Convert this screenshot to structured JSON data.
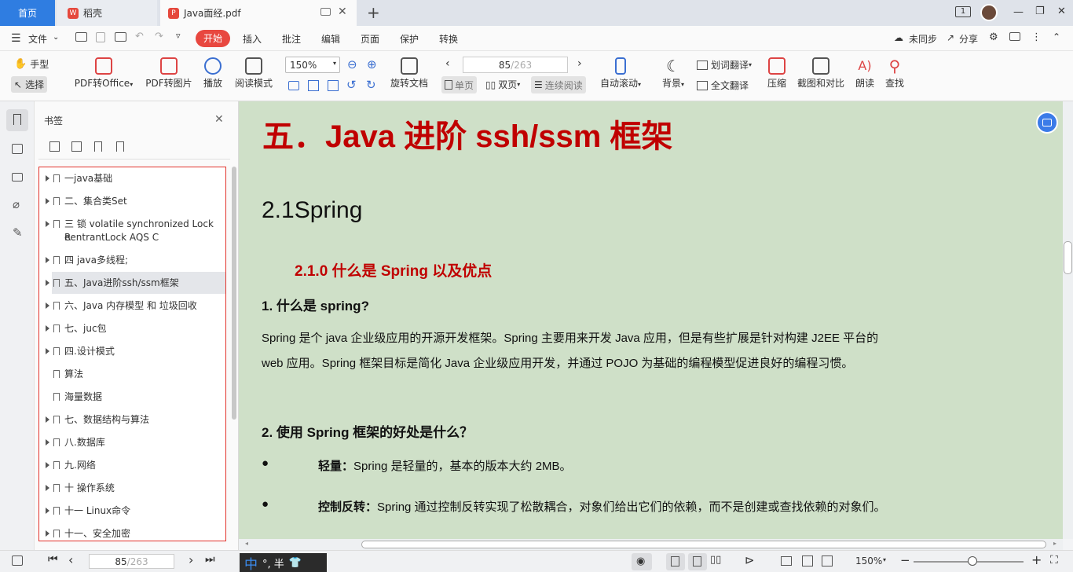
{
  "tabs": {
    "home": "首页",
    "docer": "稻壳",
    "pdf": "Java面经.pdf",
    "add": "+"
  },
  "window": {
    "minimize": "—",
    "restore": "❐",
    "close": "✕",
    "page_badge": "1"
  },
  "menu": {
    "file": "文件",
    "start": "开始",
    "insert": "插入",
    "comment": "批注",
    "edit": "编辑",
    "page": "页面",
    "protect": "保护",
    "convert": "转换",
    "unsynced": "未同步",
    "share": "分享"
  },
  "toolbar": {
    "hand": "手型",
    "select": "选择",
    "pdf2office": "PDF转Office",
    "pdf2img": "PDF转图片",
    "play": "播放",
    "read_mode": "阅读模式",
    "zoom": "150%",
    "rotate": "旋转文档",
    "page_current": "85",
    "page_total": "/263",
    "single": "单页",
    "double": "双页",
    "continuous": "连续阅读",
    "autoscroll": "自动滚动",
    "background": "背景",
    "word_translate": "划词翻译",
    "full_translate": "全文翻译",
    "compress": "压缩",
    "screenshot": "截图和对比",
    "read_aloud": "朗读",
    "find": "查找"
  },
  "panel": {
    "title": "书签",
    "close": "✕"
  },
  "bookmarks": [
    {
      "label": "一java基础",
      "arrow": true
    },
    {
      "label": "二、集合类Set",
      "arrow": true
    },
    {
      "label": "三 锁 volatile synchronized Lock R",
      "label2": "eentrantLock AQS C",
      "arrow": true
    },
    {
      "label": "四 java多线程;",
      "arrow": true
    },
    {
      "label": "五、Java进阶ssh/ssm框架",
      "arrow": true
    },
    {
      "label": "六、Java 内存模型 和 垃圾回收",
      "arrow": true
    },
    {
      "label": "七、juc包",
      "arrow": true
    },
    {
      "label": "四.设计模式",
      "arrow": true
    },
    {
      "label": "算法",
      "arrow": false
    },
    {
      "label": "海量数据",
      "arrow": false
    },
    {
      "label": "七、数据结构与算法",
      "arrow": true
    },
    {
      "label": "八.数据库",
      "arrow": true
    },
    {
      "label": "九.网络",
      "arrow": true
    },
    {
      "label": "十 操作系统",
      "arrow": true
    },
    {
      "label": "十一 Linux命令",
      "arrow": true
    },
    {
      "label": "十一、安全加密",
      "arrow": true
    }
  ],
  "document": {
    "h1": "五．Java 进阶 ssh/ssm 框架",
    "h2": "2.1Spring",
    "h3": "2.1.0  什么是 Spring  以及优点",
    "q1": "1. 什么是 spring?",
    "p1a": "Spring 是个 java 企业级应用的开源开发框架。Spring 主要用来开发 Java 应用，但是有些扩展是针对构建 J2EE 平台的",
    "p1b": "web 应用。Spring 框架目标是简化 Java 企业级应用开发，并通过 POJO 为基础的编程模型促进良好的编程习惯。",
    "q2": "2. 使用 Spring 框架的好处是什么？",
    "b1_bold": "轻量：",
    "b1_text": "Spring 是轻量的，基本的版本大约 2MB。",
    "b2_bold": "控制反转：",
    "b2_text": "Spring 通过控制反转实现了松散耦合，对象们给出它们的依赖，而不是创建或查找依赖的对象们。",
    "bullet": "●"
  },
  "status": {
    "page_current": "85",
    "page_total": "/263",
    "ime": "中",
    "ime_rest": "°, 半",
    "zoom": "150%",
    "zoom_minus": "−",
    "zoom_plus": "+"
  },
  "colors": {
    "accent": "#e8473f",
    "doc_bg": "#cfe0c8",
    "heading_red": "#c00000",
    "tab_blue": "#2f7de1"
  }
}
